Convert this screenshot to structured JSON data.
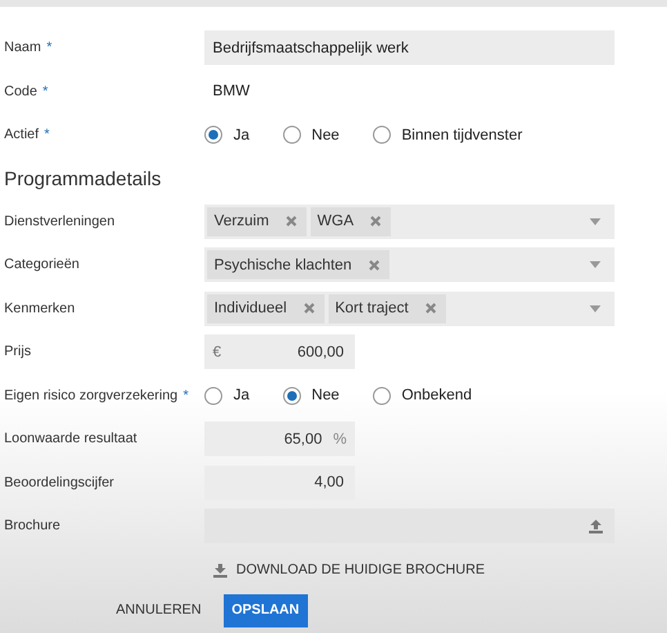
{
  "sections": [
    {
      "fields": [
        {
          "kind": "text",
          "label": "Naam",
          "required_mark": "*",
          "value": "Bedrijfsmaatschappelijk werk"
        },
        {
          "kind": "static",
          "label": "Code",
          "required_mark": "*",
          "value": "BMW"
        },
        {
          "kind": "radio",
          "label": "Actief",
          "required_mark": "*",
          "options": [
            {
              "label": "Ja",
              "selected": true
            },
            {
              "label": "Nee",
              "selected": false
            },
            {
              "label": "Binnen tijdvenster",
              "selected": false
            }
          ]
        }
      ]
    },
    {
      "title": "Programmadetails",
      "fields": [
        {
          "kind": "multiselect",
          "label": "Dienstverleningen",
          "tags": [
            "Verzuim",
            "WGA"
          ]
        },
        {
          "kind": "multiselect",
          "label": "Categorieën",
          "tags": [
            "Psychische klachten"
          ]
        },
        {
          "kind": "multiselect",
          "label": "Kenmerken",
          "tags": [
            "Individueel",
            "Kort traject"
          ]
        },
        {
          "kind": "amount",
          "label": "Prijs",
          "prefix": "€",
          "value": "600,00"
        },
        {
          "kind": "radio",
          "label": "Eigen risico zorgverzekering",
          "required_mark": "*",
          "options": [
            {
              "label": "Ja",
              "selected": false
            },
            {
              "label": "Nee",
              "selected": true
            },
            {
              "label": "Onbekend",
              "selected": false
            }
          ]
        },
        {
          "kind": "amount",
          "label": "Loonwaarde resultaat",
          "value": "65,00",
          "suffix": "%"
        },
        {
          "kind": "amount",
          "label": "Beoordelingscijfer",
          "value": "4,00"
        },
        {
          "kind": "upload",
          "label": "Brochure"
        }
      ]
    }
  ],
  "download_link": "DOWNLOAD DE HUIDIGE BROCHURE",
  "cancel_button": "ANNULEREN",
  "save_button": "OPSLAAN"
}
